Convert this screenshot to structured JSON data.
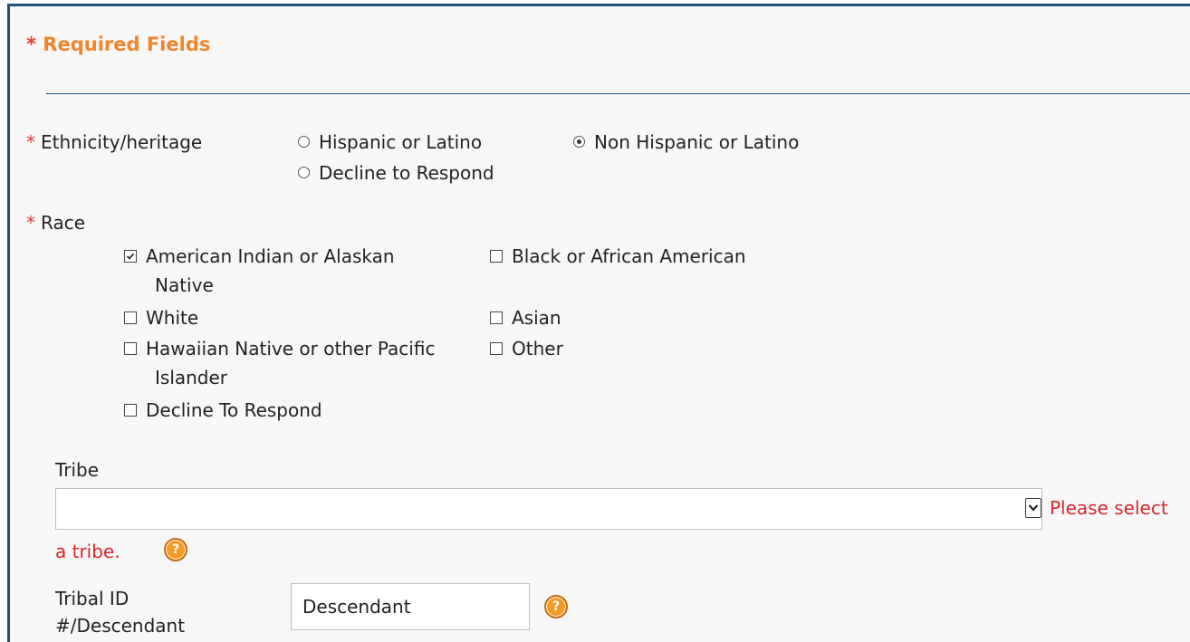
{
  "required_note": {
    "star": "*",
    "text": "Required Fields"
  },
  "ethnicity": {
    "star": "*",
    "label": "Ethnicity/heritage",
    "options": [
      {
        "label": "Hispanic or Latino",
        "checked": false
      },
      {
        "label": "Non Hispanic or Latino",
        "checked": true
      },
      {
        "label": "Decline to Respond",
        "checked": false
      }
    ]
  },
  "race": {
    "star": "*",
    "label": "Race",
    "options": [
      {
        "label": "American Indian or Alaskan Native",
        "checked": true
      },
      {
        "label": "Black or African American",
        "checked": false
      },
      {
        "label": "White",
        "checked": false
      },
      {
        "label": "Asian",
        "checked": false
      },
      {
        "label": "Hawaiian Native or other Pacific Islander",
        "checked": false
      },
      {
        "label": "Other",
        "checked": false
      },
      {
        "label": "Decline To Respond",
        "checked": false
      }
    ]
  },
  "tribe": {
    "label": "Tribe",
    "selected_value": "",
    "error_line1": "Please select",
    "error_line2": "a tribe."
  },
  "tribal_id": {
    "label_line1": "Tribal ID",
    "label_line2": "#/Descendant",
    "value": "Descendant"
  },
  "icons": {
    "help": "help-icon",
    "dropdown": "chevron-down-icon",
    "checkmark": "checkmark-icon"
  },
  "colors": {
    "accent_orange": "#f0852b",
    "required_red": "#e53935",
    "error_red": "#d9272e",
    "border_navy": "#1f4e79",
    "help_icon_orange": "#f39a27"
  }
}
